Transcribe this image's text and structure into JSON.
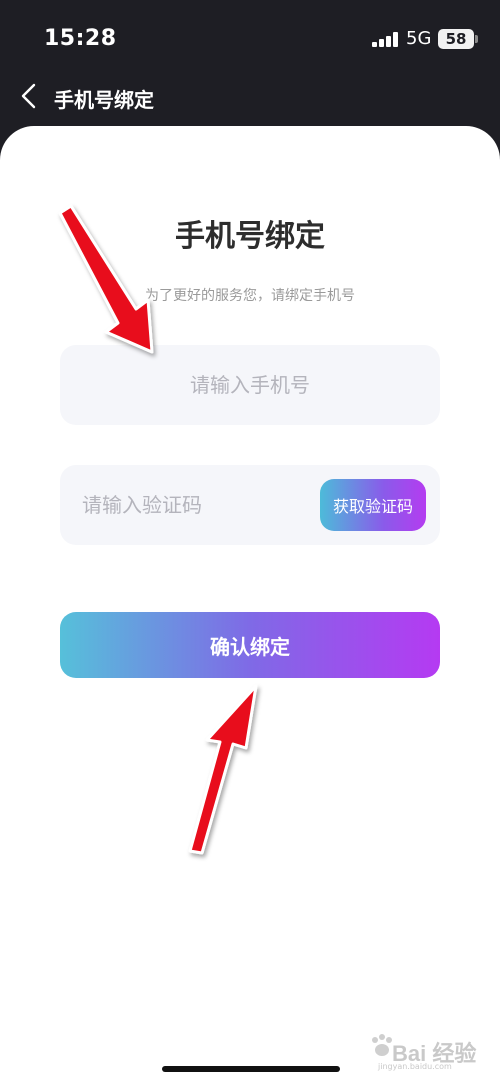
{
  "status": {
    "time": "15:28",
    "network": "5G",
    "battery": "58"
  },
  "nav": {
    "title": "手机号绑定",
    "back_icon": "chevron-left-icon"
  },
  "page": {
    "title": "手机号绑定",
    "subtitle": "为了更好的服务您，请绑定手机号"
  },
  "form": {
    "phone": {
      "value": "",
      "placeholder": "请输入手机号"
    },
    "code": {
      "value": "",
      "placeholder": "请输入验证码"
    },
    "get_code_label": "获取验证码",
    "confirm_label": "确认绑定"
  },
  "colors": {
    "gradient_start": "#56c0da",
    "gradient_end": "#b53af2",
    "annotation_arrow": "#e8101a"
  },
  "watermark": {
    "text": "Bai 经验",
    "url": "jingyan.baidu.com"
  }
}
